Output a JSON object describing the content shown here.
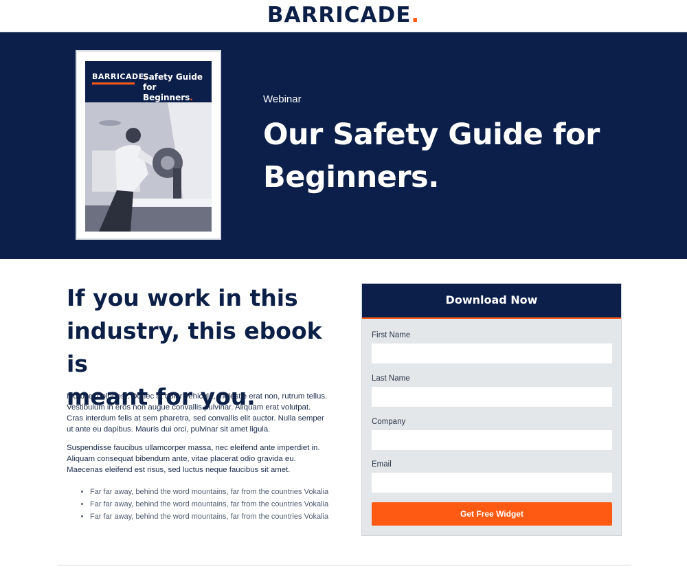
{
  "header": {
    "logo_text": "BARRICADE",
    "logo_dot": "."
  },
  "hero": {
    "eyebrow": "Webinar",
    "title_line1": "Our Safety Guide for",
    "title_line2": "Beginners.",
    "cover": {
      "logo_text": "BARRICADE",
      "logo_dot": ".",
      "title_line1": "Safety Guide",
      "title_line2": "for Beginners",
      "title_dot": "."
    }
  },
  "intro": {
    "heading_line1": "If you work in this",
    "heading_line2": "industry, this ebook is",
    "heading_line3": "meant for you.",
    "paragraph1": "Morbi et dolor est. Donec at dolor vehicula, molestie erat non, rutrum tellus. Vestibulum in eros non augue convallis pulvinar. Aliquam erat volutpat. Cras interdum felis at sem pharetra, sed convallis elit auctor. Nulla semper ut ante eu dapibus. Mauris dui orci, pulvinar sit amet ligula.",
    "paragraph2": "Suspendisse faucibus ullamcorper massa, nec eleifend ante imperdiet in. Aliquam consequat bibendum ante, vitae placerat odio gravida eu. Maecenas eleifend est risus, sed luctus neque faucibus sit amet.",
    "bullets": [
      "Far far away, behind the word mountains, far from the countries Vokalia",
      "Far far away, behind the word mountains, far from the countries Vokalia",
      "Far far away, behind the word mountains, far from the countries Vokalia"
    ]
  },
  "form": {
    "title": "Download Now",
    "fields": [
      {
        "label": "First Name",
        "value": ""
      },
      {
        "label": "Last Name",
        "value": ""
      },
      {
        "label": "Company",
        "value": ""
      },
      {
        "label": "Email",
        "value": ""
      }
    ],
    "submit_label": "Get Free Widget"
  },
  "colors": {
    "navy": "#0b1f4a",
    "accent": "#ff5a14",
    "form_bg": "#e4e7ea"
  }
}
